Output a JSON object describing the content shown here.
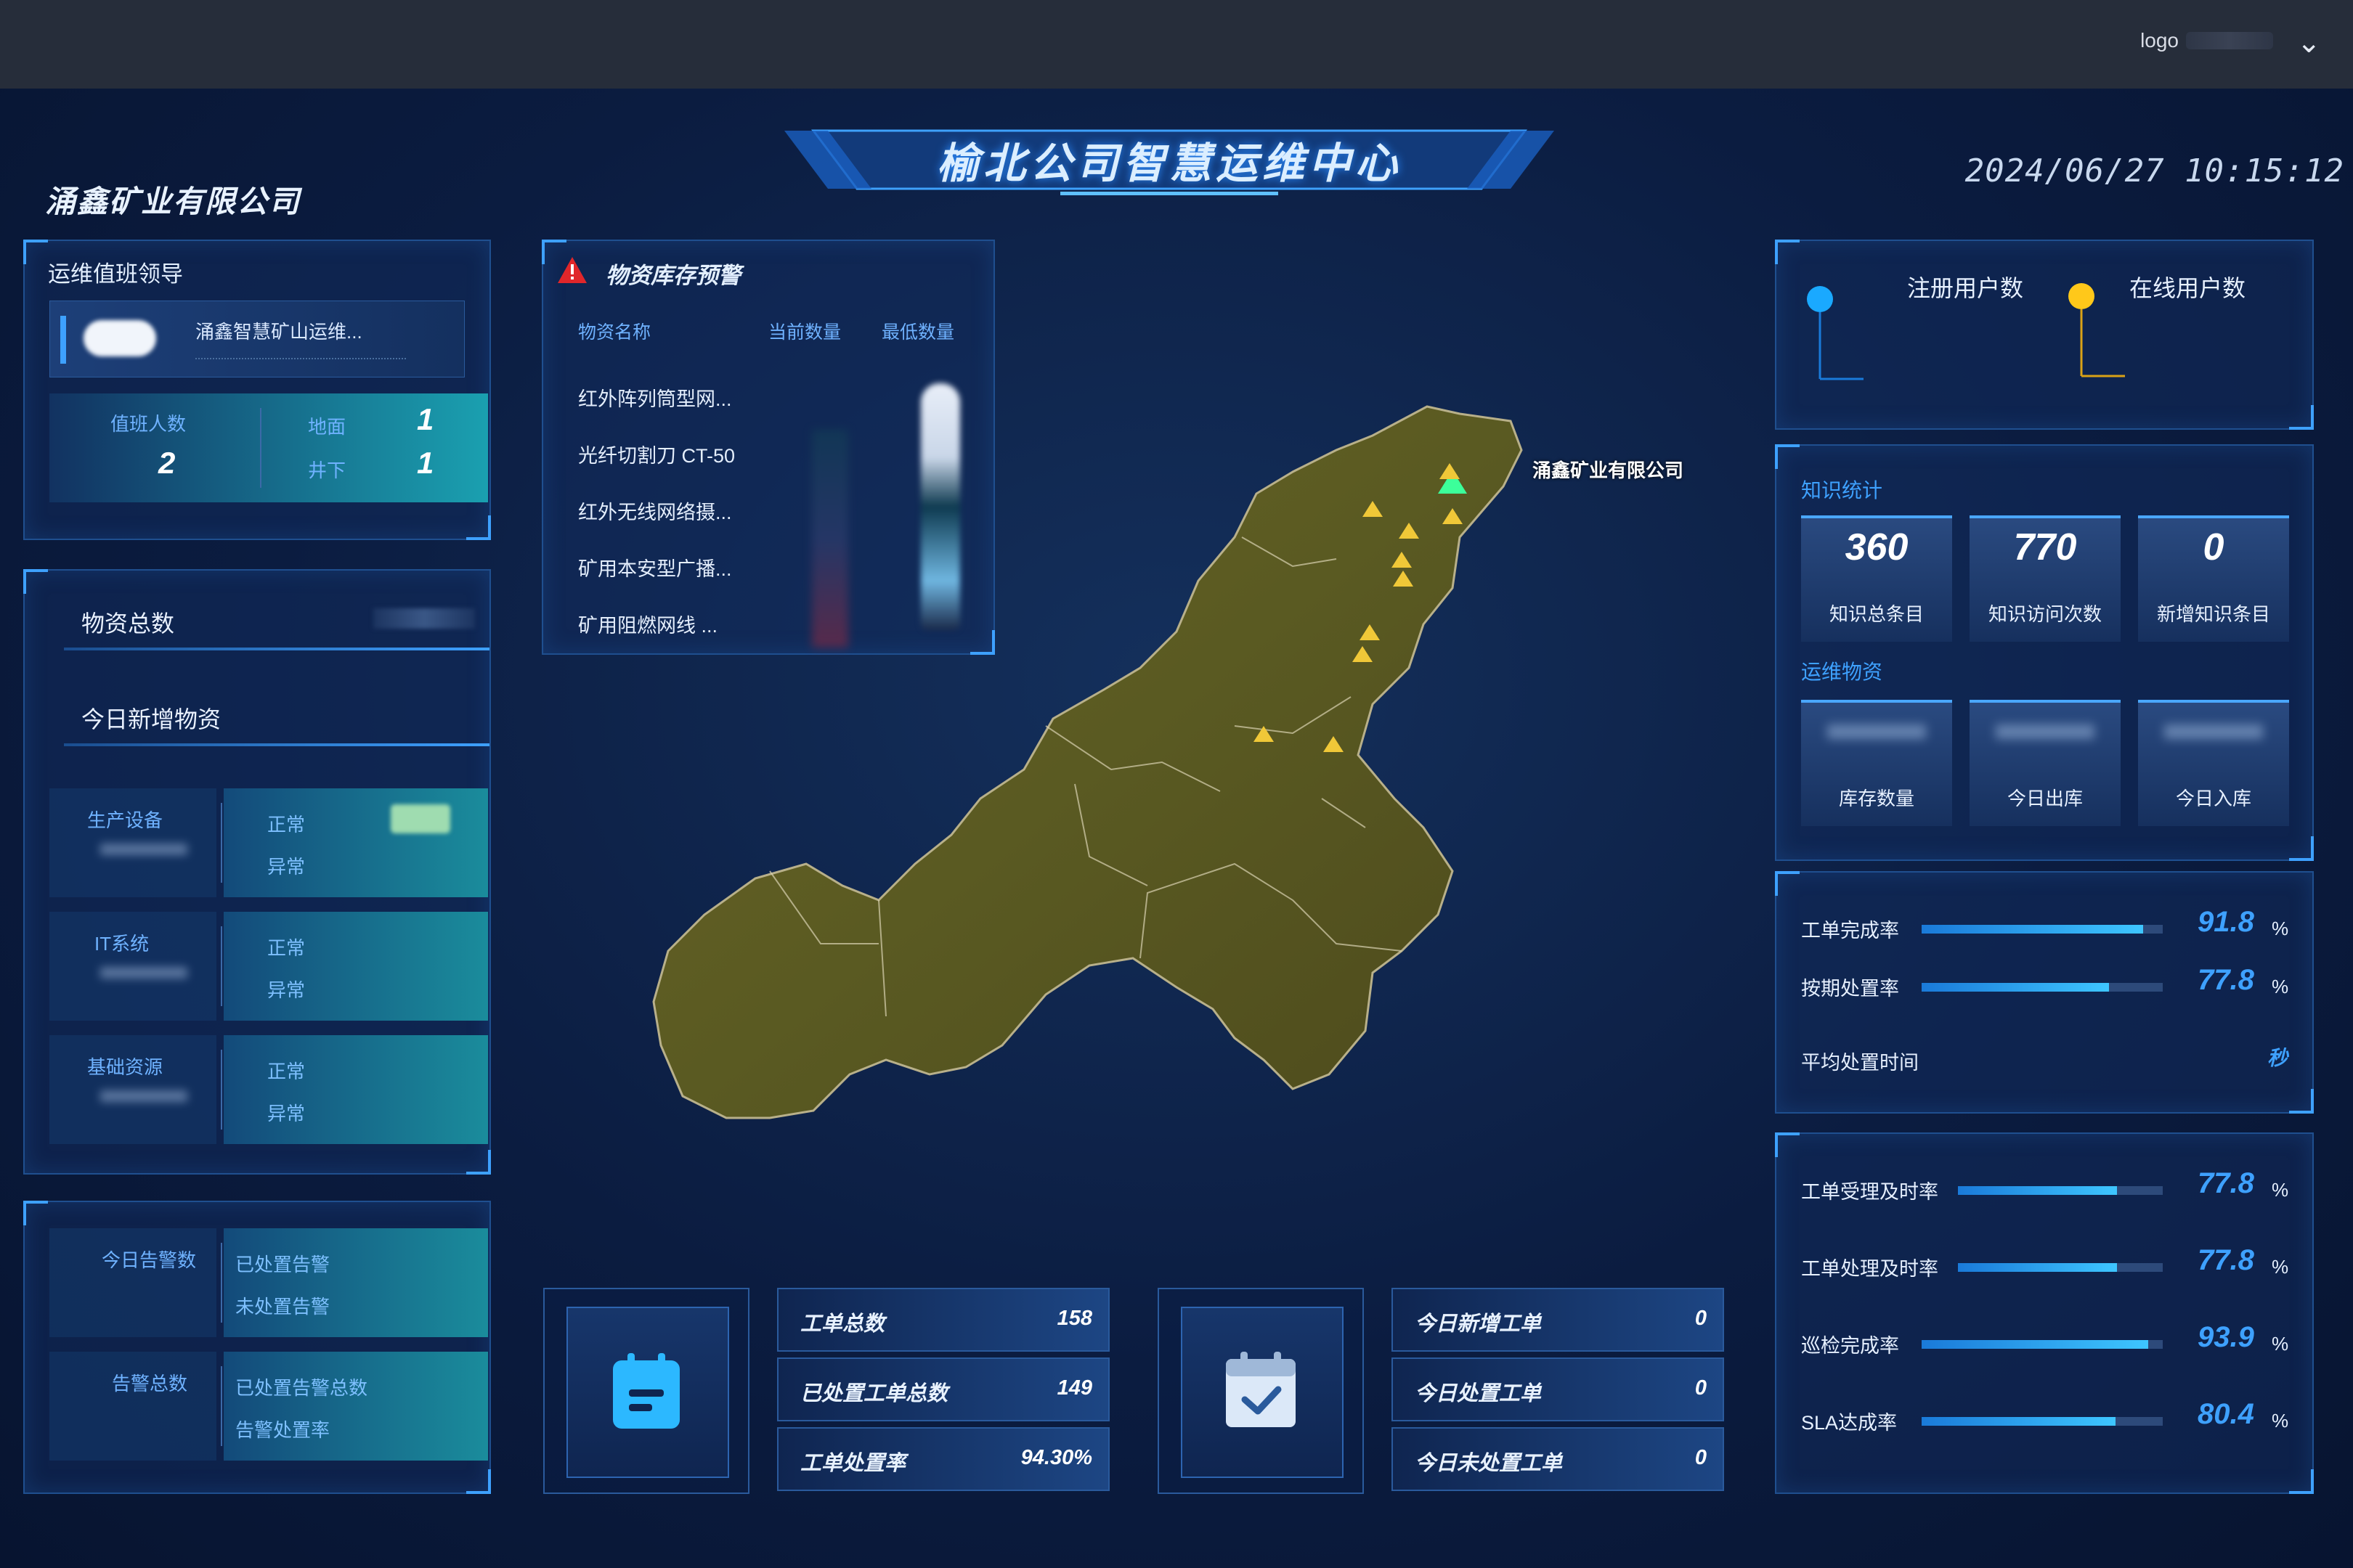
{
  "topbar": {
    "logo": "logo",
    "chevron": "⌄"
  },
  "header": {
    "title": "榆北公司智慧运维中心",
    "company": "涌鑫矿业有限公司",
    "datetime": "2024/06/27  10:15:12"
  },
  "duty": {
    "title": "运维值班领导",
    "leader_name": "涌鑫智慧矿山运维...",
    "count_label": "值班人数",
    "count_value": "2",
    "ground_label": "地面",
    "ground_value": "1",
    "underground_label": "井下",
    "underground_value": "1"
  },
  "materials": {
    "total_label": "物资总数",
    "today_label": "今日新增物资"
  },
  "resources": [
    {
      "category": "生产设备",
      "normal": "正常",
      "abnormal": "异常"
    },
    {
      "category": "IT系统",
      "normal": "正常",
      "abnormal": "异常"
    },
    {
      "category": "基础资源",
      "normal": "正常",
      "abnormal": "异常"
    }
  ],
  "alarms": [
    {
      "category": "今日告警数",
      "line1": "已处置告警",
      "line2": "未处置告警"
    },
    {
      "category": "告警总数",
      "line1": "已处置告警总数",
      "line2": "告警处置率"
    }
  ],
  "inventory": {
    "title": "物资库存预警",
    "col_name": "物资名称",
    "col_current": "当前数量",
    "col_min": "最低数量",
    "items": [
      "红外阵列筒型网...",
      "光纤切割刀 CT-50",
      "红外无线网络摄...",
      "矿用本安型广播...",
      "矿用阻燃网线 ..."
    ]
  },
  "map": {
    "label": "涌鑫矿业有限公司"
  },
  "users": {
    "registered": "注册用户数",
    "online": "在线用户数"
  },
  "knowledge": {
    "title": "知识统计",
    "items": [
      {
        "value": "360",
        "label": "知识总条目"
      },
      {
        "value": "770",
        "label": "知识访问次数"
      },
      {
        "value": "0",
        "label": "新增知识条目"
      }
    ]
  },
  "ops_materials": {
    "title": "运维物资",
    "items": [
      {
        "label": "库存数量"
      },
      {
        "label": "今日出库"
      },
      {
        "label": "今日入库"
      }
    ]
  },
  "rates1": [
    {
      "label": "工单完成率",
      "value": "91.8",
      "pct": 91.8,
      "unit": "%"
    },
    {
      "label": "按期处置率",
      "value": "77.8",
      "pct": 77.8,
      "unit": "%"
    }
  ],
  "avg_time": {
    "label": "平均处置时间",
    "value": "秒"
  },
  "rates2": [
    {
      "label": "工单受理及时率",
      "value": "77.8",
      "pct": 77.8,
      "unit": "%"
    },
    {
      "label": "工单处理及时率",
      "value": "77.8",
      "pct": 77.8,
      "unit": "%"
    },
    {
      "label": "巡检完成率",
      "value": "93.9",
      "pct": 93.9,
      "unit": "%"
    },
    {
      "label": "SLA达成率",
      "value": "80.4",
      "pct": 80.4,
      "unit": "%"
    }
  ],
  "workorders_left": [
    {
      "label": "工单总数",
      "value": "158"
    },
    {
      "label": "已处置工单总数",
      "value": "149"
    },
    {
      "label": "工单处置率",
      "value": "94.30%"
    }
  ],
  "workorders_right": [
    {
      "label": "今日新增工单",
      "value": "0"
    },
    {
      "label": "今日处置工单",
      "value": "0"
    },
    {
      "label": "今日未处置工单",
      "value": "0"
    }
  ]
}
